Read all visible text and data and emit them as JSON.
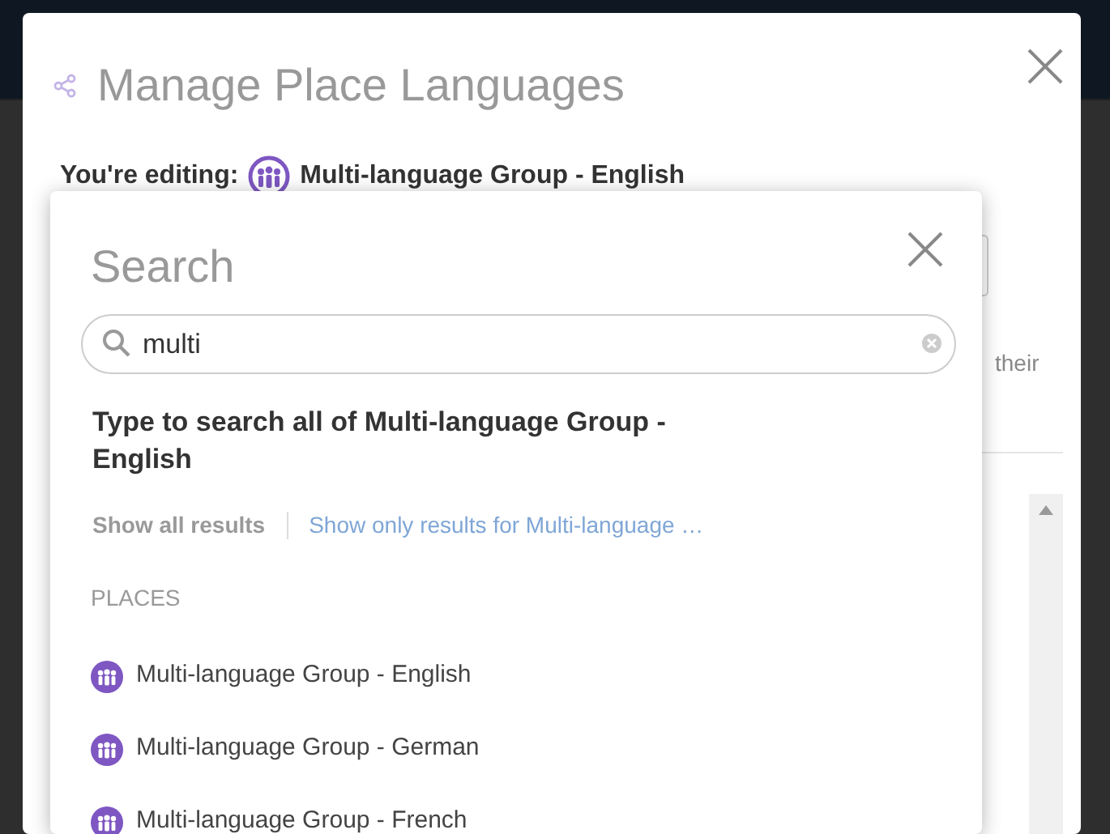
{
  "modal": {
    "title": "Manage Place Languages",
    "editing_label": "You're editing:",
    "editing_place": "Multi-language Group - English",
    "hidden_text": "their"
  },
  "search_popup": {
    "title": "Search",
    "query": "multi",
    "hint": "Type to search all of Multi-language Group - English",
    "filters": [
      {
        "label": "Show all results",
        "selected": true
      },
      {
        "label": "Show only results for Multi-language …",
        "selected": false
      }
    ],
    "section": "PLACES",
    "results": [
      {
        "label": "Multi-language Group - English"
      },
      {
        "label": "Multi-language Group - German"
      },
      {
        "label": "Multi-language Group - French"
      }
    ]
  }
}
